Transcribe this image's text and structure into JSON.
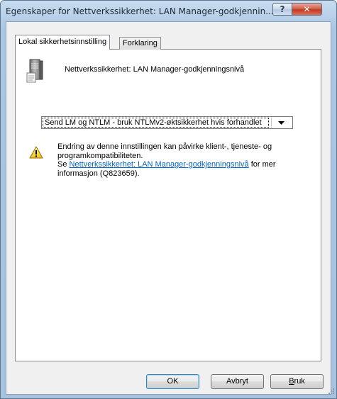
{
  "window": {
    "title": "Egenskaper for Nettverkssikkerhet: LAN Manager-godkjennin...",
    "help_button": "?",
    "close_button": "✕"
  },
  "tabs": [
    {
      "label": "Lokal sikkerhetsinnstilling",
      "active": true
    },
    {
      "label": "Forklaring",
      "active": false
    }
  ],
  "policy": {
    "icon": "server-icon",
    "name": "Nettverkssikkerhet: LAN Manager-godkjenningsnivå"
  },
  "setting": {
    "selected_value": "Send LM og NTLM - bruk NTLMv2-øktsikkerhet hvis forhandlet"
  },
  "warning": {
    "icon": "warning-icon",
    "text1": "Endring av denne innstillingen kan påvirke klient-, tjeneste- og programkompatibiliteten.",
    "see_prefix": "Se ",
    "link_text": "Nettverkssikkerhet: LAN Manager-godkjenningsnivå",
    "see_suffix": " for mer informasjon (Q823659)."
  },
  "buttons": {
    "ok": "OK",
    "cancel": "Avbryt",
    "apply_first": "B",
    "apply_rest": "ruk"
  },
  "colors": {
    "link": "#0066cc",
    "title_bar": "#b7cfe8",
    "close_button": "#c13a22"
  }
}
